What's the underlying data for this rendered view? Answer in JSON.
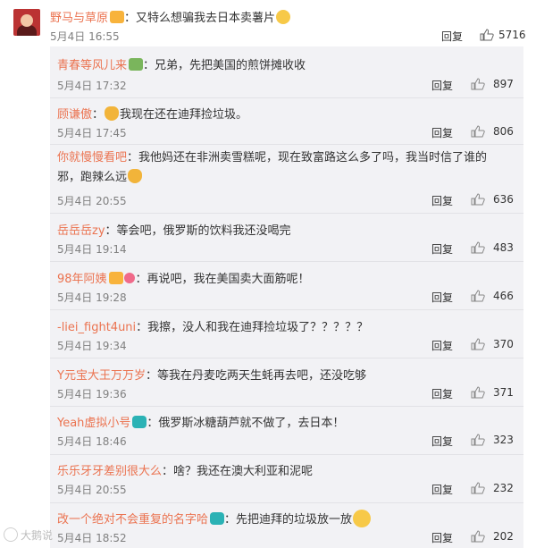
{
  "top_post": {
    "user": "野马与草原",
    "text": "：又特么想骗我去日本卖薯片",
    "time": "5月4日 16:55",
    "reply": "回复",
    "likes": "5716"
  },
  "comments": [
    {
      "user": "青春等风儿来",
      "text": "：兄弟，先把美国的煎饼摊收收",
      "time": "5月4日 17:32",
      "reply": "回复",
      "likes": "897"
    },
    {
      "user": "顾谦傲",
      "text": "我现在还在迪拜捡垃圾。",
      "time": "5月4日 17:45",
      "reply": "回复",
      "likes": "806"
    },
    {
      "user": "你就慢慢看吧",
      "text": "：我他妈还在非洲卖雪糕呢，现在致富路这么多了吗，我当时信了谁的邪，跑辣么远",
      "time": "5月4日 20:55",
      "reply": "回复",
      "likes": "636"
    },
    {
      "user": "岳岳岳zy",
      "text": "：等会吧，俄罗斯的饮料我还没喝完",
      "time": "5月4日 19:14",
      "reply": "回复",
      "likes": "483"
    },
    {
      "user": "98年阿姨",
      "text": "：再说吧，我在美国卖大面筋呢！",
      "time": "5月4日 19:28",
      "reply": "回复",
      "likes": "466"
    },
    {
      "user": "-liei_fight4uni",
      "text": "：我擦，没人和我在迪拜捡垃圾了？？？？？",
      "time": "5月4日 19:34",
      "reply": "回复",
      "likes": "370"
    },
    {
      "user": "Y元宝大王万万岁",
      "text": "：等我在丹麦吃两天生蚝再去吧，还没吃够",
      "time": "5月4日 19:36",
      "reply": "回复",
      "likes": "371"
    },
    {
      "user": "Yeah虚拟小号",
      "text": "：俄罗斯冰糖葫芦就不做了，去日本！",
      "time": "5月4日 18:46",
      "reply": "回复",
      "likes": "323"
    },
    {
      "user": "乐乐牙牙差别很大么",
      "text": "：啥？我还在澳大利亚和泥呢",
      "time": "5月4日 20:55",
      "reply": "回复",
      "likes": "232"
    },
    {
      "user": "改一个绝对不会重复的名字哈",
      "text": "：先把迪拜的垃圾放一放",
      "time": "5月4日 18:52",
      "reply": "回复",
      "likes": "202"
    }
  ],
  "watermark": "大鹅说"
}
